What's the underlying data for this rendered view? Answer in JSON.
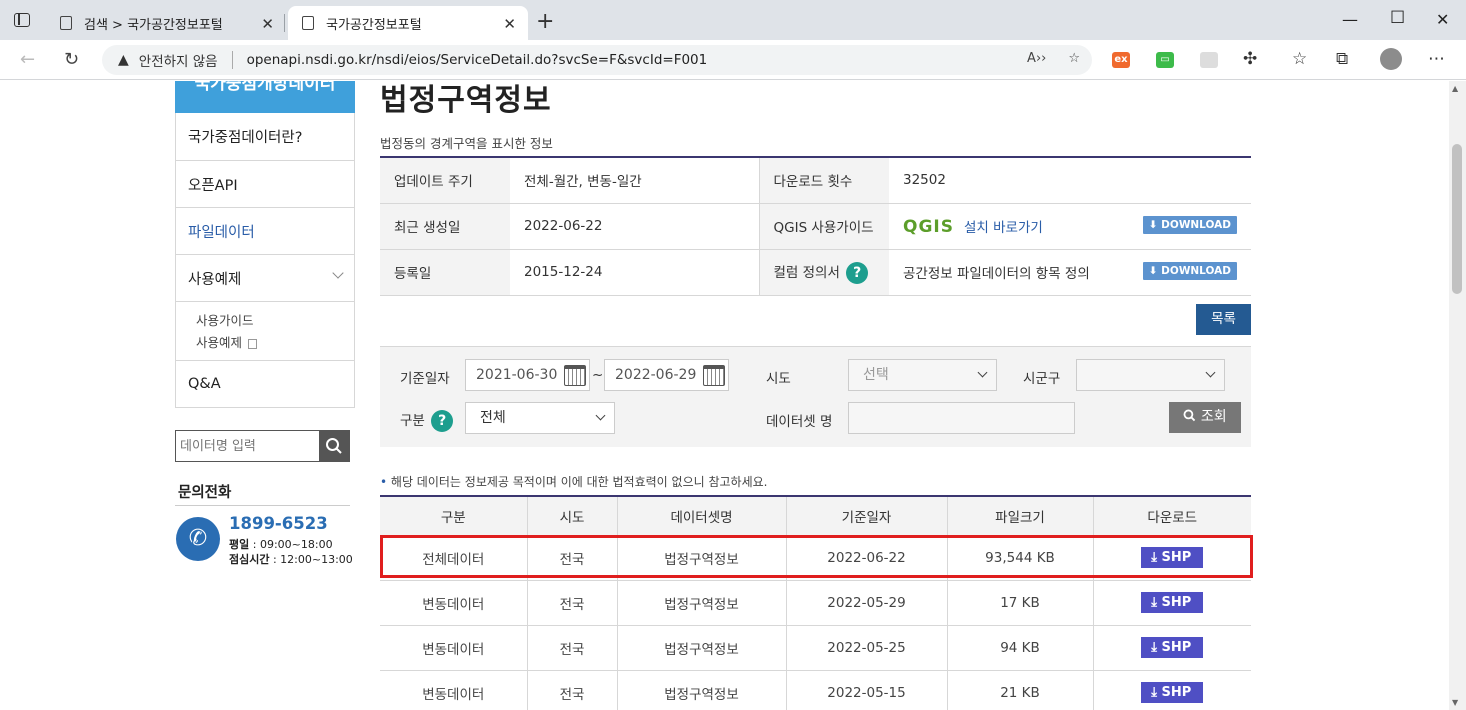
{
  "browser": {
    "tabs": [
      {
        "label": "검색 > 국가공간정보포털",
        "active": false
      },
      {
        "label": "국가공간정보포털",
        "active": true
      }
    ],
    "security_label": "안전하지 않음",
    "url": "openapi.nsdi.go.kr/nsdi/eios/ServiceDetail.do?svcSe=F&svcId=F001"
  },
  "sidebar": {
    "header": "국가중점개방데이터",
    "items": [
      {
        "label": "국가중점데이터란?"
      },
      {
        "label": "오픈API"
      },
      {
        "label": "파일데이터",
        "active": true
      },
      {
        "label": "사용예제"
      },
      {
        "label": "Q&A"
      }
    ],
    "subitems": [
      "사용가이드",
      "사용예제"
    ],
    "search_placeholder": "데이터명 입력",
    "contact_title": "문의전화",
    "phone": "1899-6523",
    "hours_weekday_label": "평일",
    "hours_weekday": " : 09:00~18:00",
    "hours_lunch_label": "점심시간",
    "hours_lunch": " : 12:00~13:00"
  },
  "main": {
    "title": "법정구역정보",
    "description": "법정동의 경계구역을 표시한 정보",
    "info": {
      "update_label": "업데이트 주기",
      "update_value": "전체-월간, 변동-일간",
      "download_count_label": "다운로드 횟수",
      "download_count": "32502",
      "created_label": "최근 생성일",
      "created_value": "2022-06-22",
      "qgis_label": "QGIS 사용가이드",
      "qgis_logo": "QGIS",
      "qgis_link": "설치 바로가기",
      "registered_label": "등록일",
      "registered_value": "2015-12-24",
      "column_label": "컬럼 정의서",
      "column_value": "공간정보 파일데이터의 항목 정의",
      "download_btn": "DOWNLOAD"
    },
    "list_button": "목록",
    "filter": {
      "date_label": "기준일자",
      "date_from": "2021-06-30",
      "date_to": "2022-06-29",
      "sido_label": "시도",
      "sido_value": "선택",
      "sigungu_label": "시군구",
      "sigungu_value": "",
      "type_label": "구분",
      "type_value": "전체",
      "dataset_label": "데이터셋 명",
      "dataset_value": "",
      "search_button": "조회"
    },
    "notice": "해당 데이터는 정보제공 목적이며 이에 대한 법적효력이 없으니 참고하세요.",
    "table": {
      "headers": [
        "구분",
        "시도",
        "데이터셋명",
        "기준일자",
        "파일크기",
        "다운로드"
      ],
      "rows": [
        {
          "type": "전체데이터",
          "sido": "전국",
          "dataset": "법정구역정보",
          "date": "2022-06-22",
          "size": "93,544 KB",
          "download": "SHP"
        },
        {
          "type": "변동데이터",
          "sido": "전국",
          "dataset": "법정구역정보",
          "date": "2022-05-29",
          "size": "17 KB",
          "download": "SHP"
        },
        {
          "type": "변동데이터",
          "sido": "전국",
          "dataset": "법정구역정보",
          "date": "2022-05-25",
          "size": "94 KB",
          "download": "SHP"
        },
        {
          "type": "변동데이터",
          "sido": "전국",
          "dataset": "법정구역정보",
          "date": "2022-05-15",
          "size": "21 KB",
          "download": "SHP"
        }
      ]
    }
  }
}
